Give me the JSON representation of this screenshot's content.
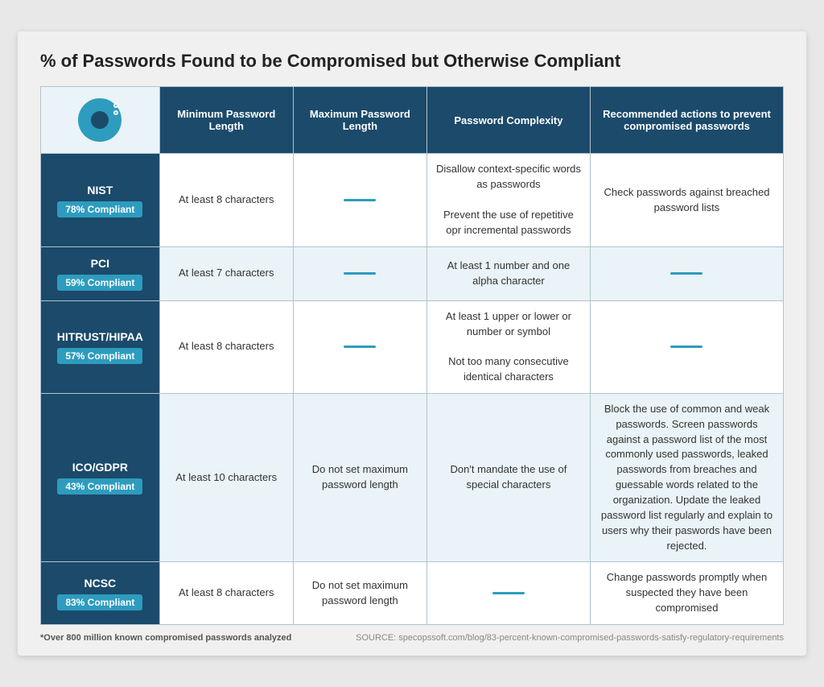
{
  "title": "% of Passwords Found to be Compromised but Otherwise Compliant",
  "table": {
    "headers": {
      "col1": "",
      "col2": "Minimum Password Length",
      "col3": "Maximum Password Length",
      "col4": "Password Complexity",
      "col5": "Recommended actions to prevent compromised passwords"
    },
    "rows": [
      {
        "id": "nist",
        "standard": "NIST",
        "compliance": "78% Compliant",
        "min_length": "At least 8 characters",
        "max_length": "dash",
        "complexity": "Disallow context-specific words as passwords\n\nPrevent the use of repetitive opr incremental passwords",
        "recommended": "Check passwords against breached password lists"
      },
      {
        "id": "pci",
        "standard": "PCI",
        "compliance": "59% Compliant",
        "min_length": "At least 7 characters",
        "max_length": "dash",
        "complexity": "At least 1 number and one alpha character",
        "recommended": "dash"
      },
      {
        "id": "hitrust",
        "standard": "HITRUST/HIPAA",
        "compliance": "57% Compliant",
        "min_length": "At least 8 characters",
        "max_length": "dash",
        "complexity": "At least 1 upper or lower or number or symbol\n\nNot too many consecutive identical characters",
        "recommended": "dash"
      },
      {
        "id": "ico",
        "standard": "ICO/GDPR",
        "compliance": "43% Compliant",
        "min_length": "At least 10 characters",
        "max_length": "Do not set maximum password length",
        "complexity": "Don't mandate the use of special characters",
        "recommended": "Block the use of common and weak passwords. Screen  passwords against a password list of the most commonly used passwords, leaked passwords from breaches and guessable words related to the organization. Update the leaked password list regularly and explain to users why their paswords have been rejected."
      },
      {
        "id": "ncsc",
        "standard": "NCSC",
        "compliance": "83% Compliant",
        "min_length": "At least 8 characters",
        "max_length": "Do not set maximum password length",
        "complexity": "dash",
        "recommended": "Change passwords promptly when suspected they have been compromised"
      }
    ]
  },
  "footer": {
    "left": "*Over 800 million known compromised passwords analyzed",
    "right": "SOURCE: specopssoft.com/blog/83-percent-known-compromised-passwords-satisfy-regulatory-requirements"
  }
}
